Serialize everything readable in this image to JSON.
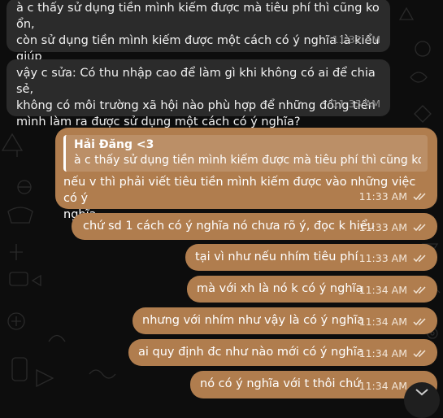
{
  "messages": [
    {
      "dir": "in",
      "text": "à c thấy sử dụng tiền mình kiếm được mà tiêu phí thì cũng ko ổn,\ncòn sử dụng tiền mình kiếm được một cách có ý nghĩa là kiểu giúp\nđời, làm từ thiện đồ á ))",
      "time": "11:32 AM"
    },
    {
      "dir": "in",
      "text": "vậy c sửa: Có thu nhập cao để làm gì khi không có ai để chia sẻ,\nkhông có môi trường xã hội nào phù hợp để những đồng tiền\nmình làm ra được sử dụng một cách có ý nghĩa?",
      "time": "11:33 AM"
    },
    {
      "dir": "out",
      "reply_name": "Hải Đăng <3",
      "reply_text": "à c thấy sử dụng tiền mình kiếm được mà tiêu phí thì cũng ko ...",
      "text": "nếu v thì phải viết tiêu tiền mình kiếm được vào những việc có ý\nnghĩa",
      "time": "11:33 AM",
      "status": "read"
    },
    {
      "dir": "out",
      "text": "chứ sd 1 cách có ý nghĩa nó chưa rõ ý, đọc k hiểu",
      "time": "11:33 AM",
      "status": "read"
    },
    {
      "dir": "out",
      "text": "tại vì như nếu nhím tiêu phí",
      "time": "11:33 AM",
      "status": "read"
    },
    {
      "dir": "out",
      "text": "mà với xh là nó k có ý nghĩa",
      "time": "11:34 AM",
      "status": "read"
    },
    {
      "dir": "out",
      "text": "nhưng với nhím như vậy là có ý nghĩa",
      "time": "11:34 AM",
      "status": "read"
    },
    {
      "dir": "out",
      "text": "ai quy định đc như nào mới có ý nghĩa",
      "time": "11:34 AM",
      "status": "read"
    },
    {
      "dir": "out",
      "text": "nó có ý nghĩa với t thôi chứ",
      "time": "11:34 AM",
      "status": "read"
    }
  ],
  "icons": {
    "read_status": "double-check-icon",
    "scroll_down": "chevron-down-icon"
  },
  "colors": {
    "background": "#0d0d0d",
    "incoming_bubble": "#2b2b2b",
    "outgoing_bubble": "#b07d4e"
  }
}
